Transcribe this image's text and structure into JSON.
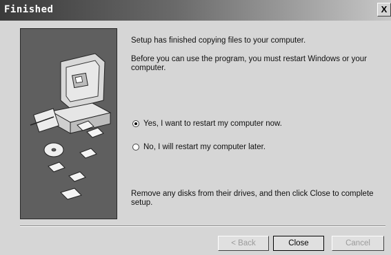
{
  "window": {
    "title": "Finished",
    "close_glyph": "X"
  },
  "main": {
    "message_copy": "Setup has finished copying files to your computer.",
    "message_restart": "Before you can use the program, you must restart Windows or your computer.",
    "radio_options": [
      {
        "label": "Yes, I want to restart my computer now.",
        "selected": true
      },
      {
        "label": "No, I will restart my computer later.",
        "selected": false
      }
    ],
    "message_disks": "Remove any disks from their drives, and then click Close to complete setup."
  },
  "buttons": {
    "back_label": "< Back",
    "close_label": "Close",
    "cancel_label": "Cancel"
  },
  "colors": {
    "art_background": "#5f5f5f",
    "title_gradient_start": "#3a3a3a"
  },
  "icons": {
    "computer": "computer-icon",
    "floppy": "floppy-disk-icon",
    "cd": "cd-icon",
    "radio_selected": "radio-selected",
    "radio_unselected": "radio-unselected"
  }
}
